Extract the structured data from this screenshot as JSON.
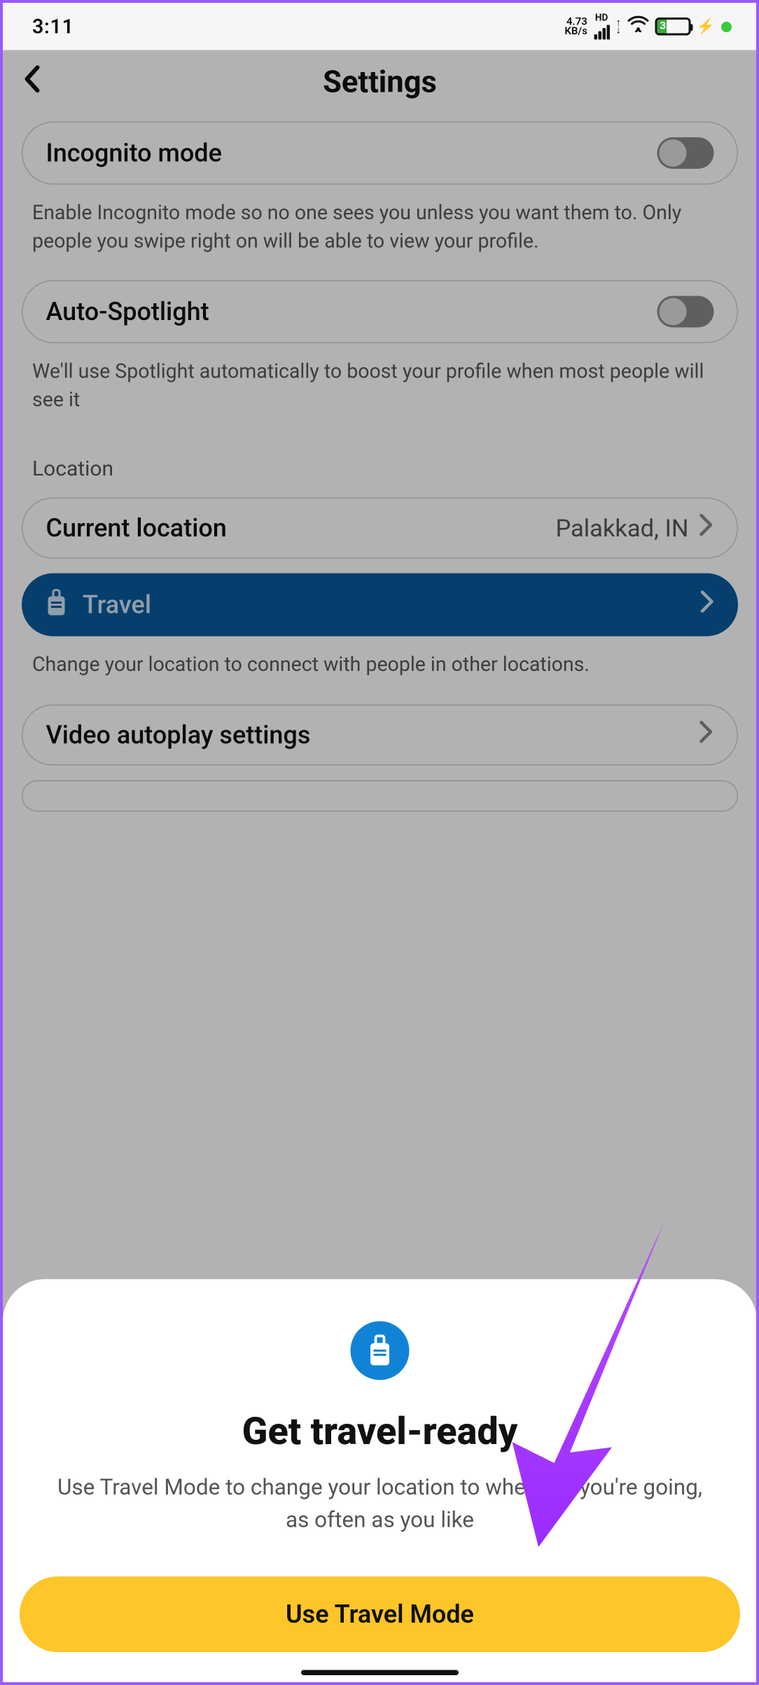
{
  "status": {
    "time": "3:11",
    "kbps_value": "4.73",
    "kbps_unit": "KB/s",
    "hd": "HD",
    "battery_percent": "32"
  },
  "header": {
    "title": "Settings"
  },
  "settings": {
    "incognito": {
      "label": "Incognito mode",
      "desc": "Enable Incognito mode so no one sees you unless you want them to. Only people you swipe right on will be able to view your profile."
    },
    "spotlight": {
      "label": "Auto-Spotlight",
      "desc": "We'll use Spotlight automatically to boost your profile when most people will see it"
    },
    "location_section": "Location",
    "current_location": {
      "label": "Current location",
      "value": "Palakkad, IN"
    },
    "travel": {
      "label": "Travel",
      "desc": "Change your location to connect with people in other locations."
    },
    "video": {
      "label": "Video autoplay settings"
    }
  },
  "sheet": {
    "title": "Get travel-ready",
    "desc": "Use Travel Mode to change your location to wherever you're going, as often as you like",
    "button": "Use Travel Mode"
  }
}
